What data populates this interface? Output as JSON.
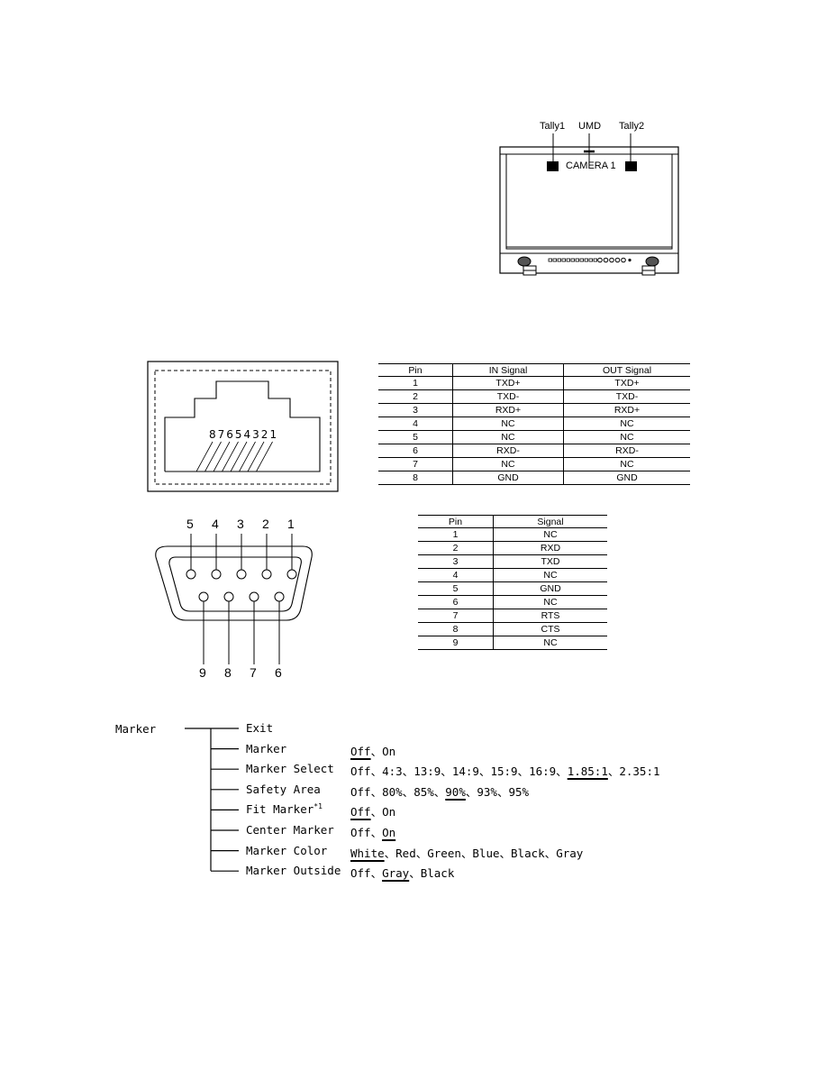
{
  "monitor_diagram": {
    "labels": {
      "tally1": "Tally1",
      "umd": "UMD",
      "tally2": "Tally2"
    },
    "umd_text": "CAMERA 1"
  },
  "rj45_diagram": {
    "pin_numbers": "87654321"
  },
  "rj45_table": {
    "headers": [
      "Pin",
      "IN Signal",
      "OUT Signal"
    ],
    "rows": [
      [
        "1",
        "TXD+",
        "TXD+"
      ],
      [
        "2",
        "TXD-",
        "TXD-"
      ],
      [
        "3",
        "RXD+",
        "RXD+"
      ],
      [
        "4",
        "NC",
        "NC"
      ],
      [
        "5",
        "NC",
        "NC"
      ],
      [
        "6",
        "RXD-",
        "RXD-"
      ],
      [
        "7",
        "NC",
        "NC"
      ],
      [
        "8",
        "GND",
        "GND"
      ]
    ]
  },
  "db9_diagram": {
    "top_pins": [
      "5",
      "4",
      "3",
      "2",
      "1"
    ],
    "bottom_pins": [
      "9",
      "8",
      "7",
      "6"
    ]
  },
  "db9_table": {
    "headers": [
      "Pin",
      "Signal"
    ],
    "rows": [
      [
        "1",
        "NC"
      ],
      [
        "2",
        "RXD"
      ],
      [
        "3",
        "TXD"
      ],
      [
        "4",
        "NC"
      ],
      [
        "5",
        "GND"
      ],
      [
        "6",
        "NC"
      ],
      [
        "7",
        "RTS"
      ],
      [
        "8",
        "CTS"
      ],
      [
        "9",
        "NC"
      ]
    ]
  },
  "marker_menu": {
    "root": "Marker",
    "items": [
      {
        "label": "Exit",
        "options": []
      },
      {
        "label": "Marker",
        "options": [
          "Off",
          "On"
        ],
        "default": "Off"
      },
      {
        "label": "Marker Select",
        "options": [
          "Off",
          "4:3",
          "13:9",
          "14:9",
          "15:9",
          "16:9",
          "1.85:1",
          "2.35:1"
        ],
        "default": "1.85:1"
      },
      {
        "label": "Safety Area",
        "options": [
          "Off",
          "80%",
          "85%",
          "90%",
          "93%",
          "95%"
        ],
        "default": "90%"
      },
      {
        "label": "Fit Marker",
        "footnote": "*1",
        "options": [
          "Off",
          "On"
        ],
        "default": "Off"
      },
      {
        "label": "Center Marker",
        "options": [
          "Off",
          "On"
        ],
        "default": "On"
      },
      {
        "label": "Marker Color",
        "options": [
          "White",
          "Red",
          "Green",
          "Blue",
          "Black",
          "Gray"
        ],
        "default": "White"
      },
      {
        "label": "Marker Outside",
        "options": [
          "Off",
          "Gray",
          "Black"
        ],
        "default": "Gray"
      }
    ],
    "separator": "、"
  }
}
